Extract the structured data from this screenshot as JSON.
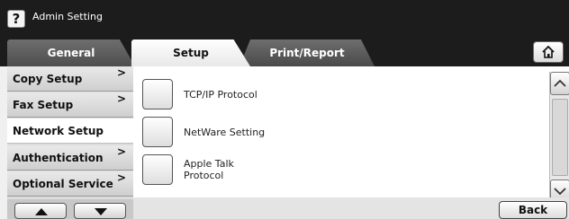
{
  "window": {
    "title": "Admin Setting",
    "help_label": "?"
  },
  "tabs": [
    {
      "label": "General",
      "active": false
    },
    {
      "label": "Setup",
      "active": true
    },
    {
      "label": "Print/Report",
      "active": false
    }
  ],
  "home_icon": "home-icon",
  "sidebar": {
    "items": [
      {
        "label": "Copy Setup",
        "chevron": ">",
        "selected": false
      },
      {
        "label": "Fax Setup",
        "chevron": ">",
        "selected": false
      },
      {
        "label": "Network Setup",
        "chevron": "",
        "selected": true
      },
      {
        "label": "Authentication",
        "chevron": ">",
        "selected": false
      },
      {
        "label": "Optional Service",
        "chevron": ">",
        "selected": false
      }
    ]
  },
  "main": {
    "options": [
      {
        "label": "TCP/IP Protocol"
      },
      {
        "label": "NetWare Setting"
      },
      {
        "label": "Apple Talk Protocol",
        "line1": "Apple Talk",
        "line2": "Protocol"
      }
    ]
  },
  "footer": {
    "back_label": "Back"
  },
  "colors": {
    "titlebar": "#1c1c1c",
    "tab_active": "#ffffff",
    "tab_inactive": "#5a5a5a"
  }
}
